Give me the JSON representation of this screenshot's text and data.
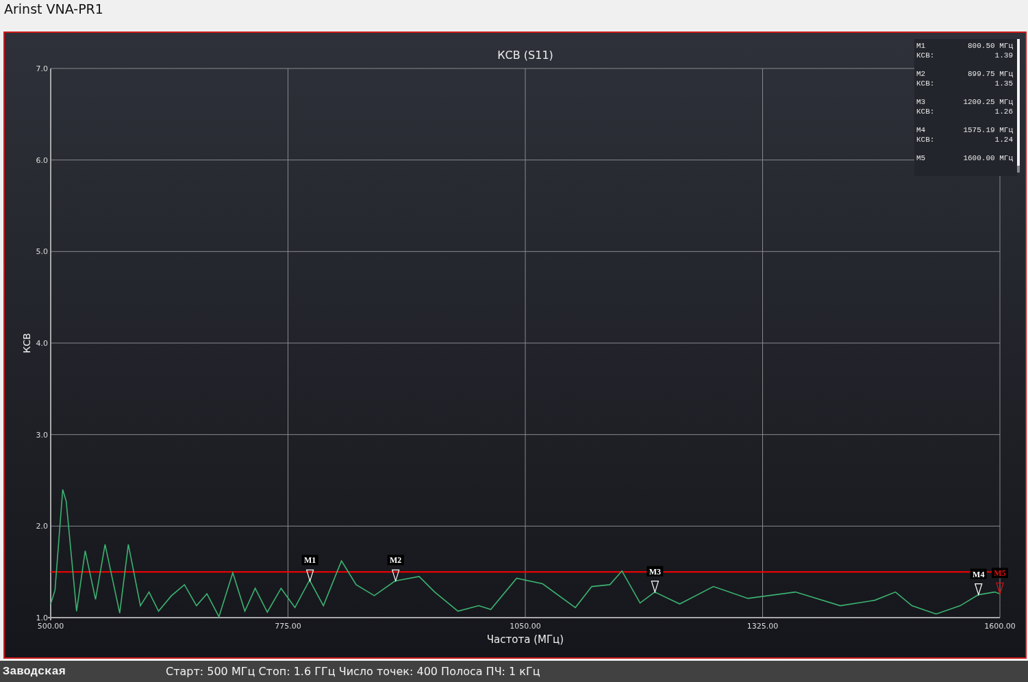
{
  "window": {
    "title": "Arinst VNA-PR1"
  },
  "chart": {
    "chart_data": {
      "type": "line",
      "title": "КСВ (S11)",
      "xlabel": "Частота (МГц)",
      "ylabel": "КСВ",
      "x": [
        500,
        505,
        514,
        518,
        530,
        540,
        552,
        563,
        580,
        590,
        604,
        614,
        625,
        640,
        655,
        669,
        681,
        695,
        711,
        725,
        737,
        751,
        767,
        783,
        800,
        816,
        837,
        854,
        875,
        899,
        927,
        945,
        972,
        996,
        1010,
        1040,
        1070,
        1108,
        1127,
        1148,
        1162,
        1183,
        1200,
        1229,
        1268,
        1308,
        1363,
        1415,
        1455,
        1479,
        1498,
        1526,
        1554,
        1575,
        1594,
        1600
      ],
      "grid": true,
      "series": [
        {
          "color": "#3cb371",
          "values": [
            1.15,
            1.3,
            2.4,
            2.27,
            1.07,
            1.73,
            1.2,
            1.8,
            1.05,
            1.8,
            1.13,
            1.28,
            1.07,
            1.24,
            1.36,
            1.13,
            1.26,
            1.01,
            1.49,
            1.07,
            1.32,
            1.06,
            1.32,
            1.11,
            1.41,
            1.13,
            1.62,
            1.36,
            1.24,
            1.4,
            1.45,
            1.28,
            1.07,
            1.13,
            1.09,
            1.43,
            1.37,
            1.11,
            1.34,
            1.36,
            1.51,
            1.16,
            1.28,
            1.15,
            1.34,
            1.21,
            1.28,
            1.13,
            1.19,
            1.28,
            1.13,
            1.04,
            1.13,
            1.25,
            1.28,
            1.26
          ]
        }
      ],
      "xlim": [
        500,
        1600
      ],
      "ylim": [
        1,
        7
      ],
      "xticks": [
        {
          "value": 500,
          "label": "500.00"
        },
        {
          "value": 775,
          "label": "775.00"
        },
        {
          "value": 1050,
          "label": "1050.00"
        },
        {
          "value": 1325,
          "label": "1325.00"
        },
        {
          "value": 1600,
          "label": "1600.00"
        }
      ],
      "yticks": [
        {
          "value": 1,
          "label": "1.0"
        },
        {
          "value": 2,
          "label": "2.0"
        },
        {
          "value": 3,
          "label": "3.0"
        },
        {
          "value": 4,
          "label": "4.0"
        },
        {
          "value": 5,
          "label": "5.0"
        },
        {
          "value": 6,
          "label": "6.0"
        },
        {
          "value": 7,
          "label": "7.0"
        }
      ],
      "ref_lines": [
        {
          "axis": "y",
          "value": 1.5,
          "color": "#ff0000"
        }
      ]
    },
    "markers": [
      {
        "label": "M1",
        "selected": false
      },
      {
        "label": "M2",
        "selected": false
      },
      {
        "label": "M3",
        "selected": false
      },
      {
        "label": "M4",
        "selected": false
      },
      {
        "label": "M5",
        "selected": true
      }
    ],
    "marker_table": [
      {
        "name": "M1",
        "frequency": "800.50 МГц",
        "value_label": "КСВ:",
        "value": "1.39"
      },
      {
        "name": "M2",
        "frequency": "899.75 МГц",
        "value_label": "КСВ:",
        "value": "1.35"
      },
      {
        "name": "M3",
        "frequency": "1200.25 МГц",
        "value_label": "КСВ:",
        "value": "1.26"
      },
      {
        "name": "M4",
        "frequency": "1575.19 МГц",
        "value_label": "КСВ:",
        "value": "1.24"
      },
      {
        "name": "M5",
        "frequency": "1600.00 МГц"
      }
    ]
  },
  "status_bar": {
    "profile": "Заводская",
    "info": "Старт: 500 МГц Стоп: 1.6 ГГц Число точек: 400 Полоса ПЧ: 1 кГц"
  }
}
